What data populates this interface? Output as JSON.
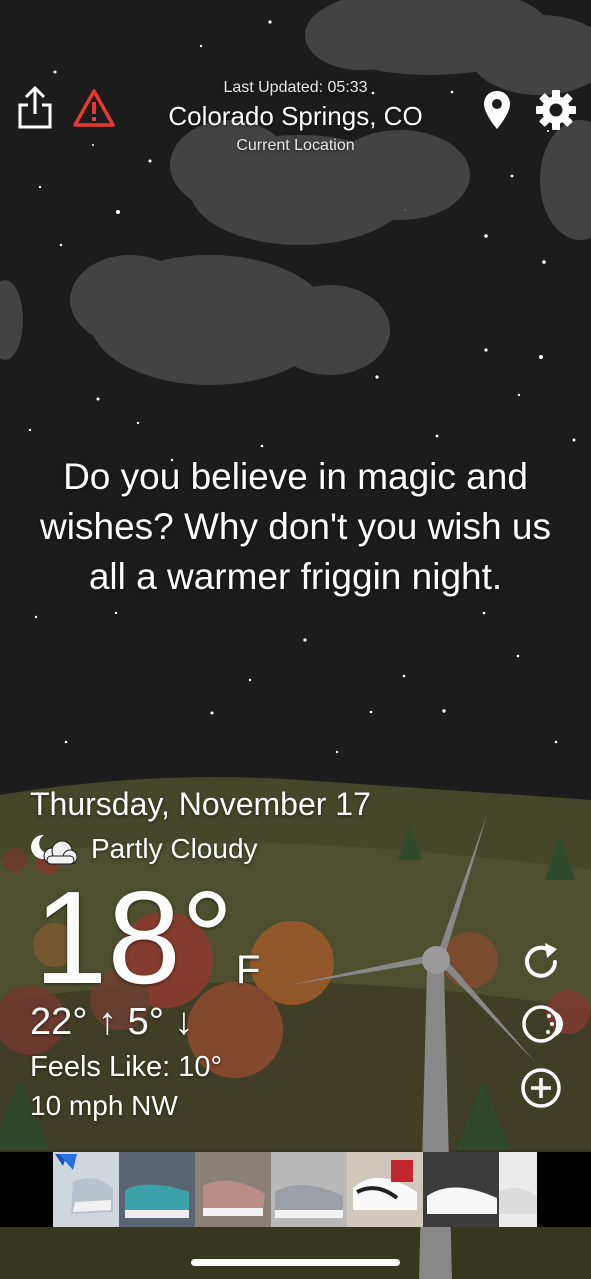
{
  "header": {
    "last_updated": "Last Updated: 05:33",
    "location": "Colorado Springs, CO",
    "location_sub": "Current Location"
  },
  "message": "Do you believe in magic and wishes? Why don't you wish us all a warmer friggin night.",
  "weather": {
    "date": "Thursday, November 17",
    "condition": "Partly Cloudy",
    "temperature": "18°",
    "unit": "F",
    "hi_lo": "22° ↑ 5° ↓",
    "feels_like": "Feels Like: 10°",
    "wind": "10 mph NW"
  },
  "icons": {
    "share": "share-icon",
    "alert": "warning-icon",
    "location": "location-pin-icon",
    "settings": "gear-icon",
    "condition": "partly-cloudy-night-icon",
    "refresh": "refresh-icon",
    "moon": "moon-phase-icon",
    "add": "add-circle-icon"
  },
  "colors": {
    "sky": "#1c1c1d",
    "alert": "#e8392f",
    "hills": "#4a4a2c",
    "ground": "#3c3a22"
  }
}
